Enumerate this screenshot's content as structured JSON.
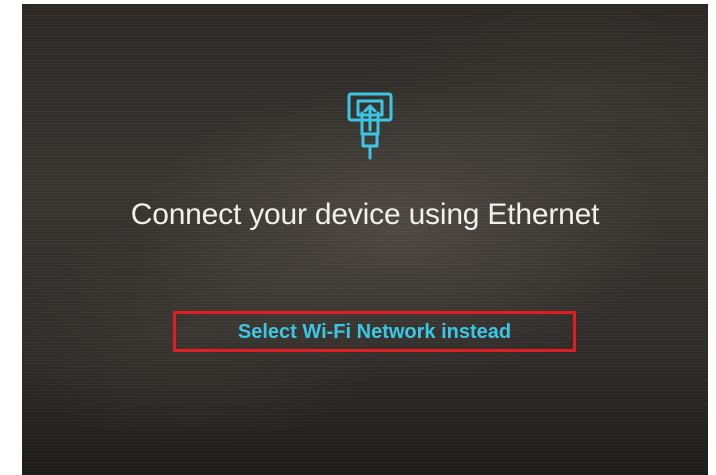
{
  "screen": {
    "icon": "ethernet-cable-icon",
    "title": "Connect your device using Ethernet",
    "wifi_link_label": "Select Wi-Fi Network instead"
  },
  "colors": {
    "accent": "#3cc6e6",
    "highlight_box": "#e11d24",
    "title_text": "#f2f0ed"
  }
}
